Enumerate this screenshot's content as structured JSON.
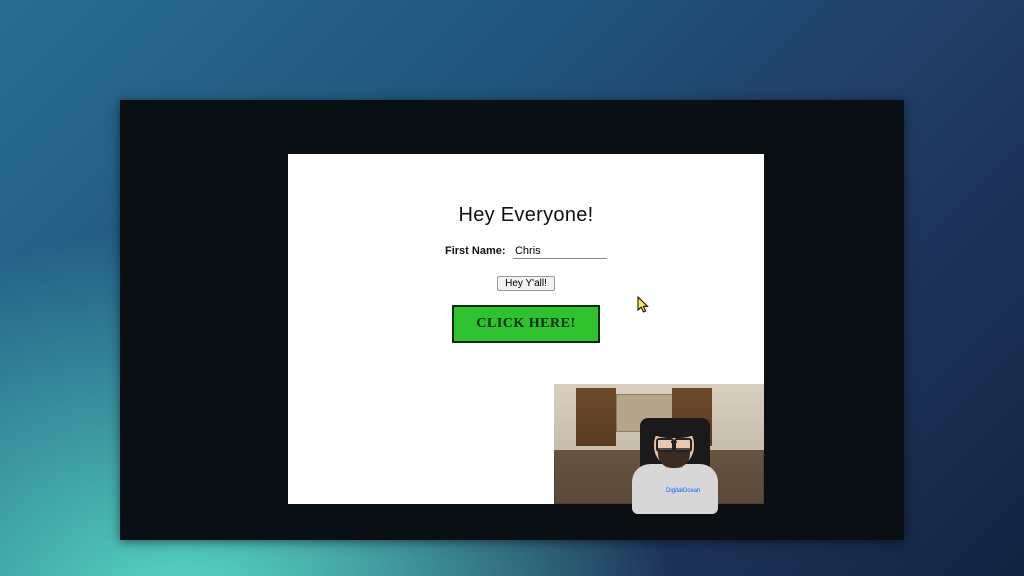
{
  "page": {
    "heading": "Hey Everyone!",
    "first_name_label": "First Name:",
    "first_name_value": "Chris",
    "small_button_label": "Hey Y'all!",
    "big_button_label": "CLICK HERE!"
  },
  "webcam": {
    "shirt_logo": "DigitalOcean"
  },
  "colors": {
    "big_button_bg": "#2fc22f",
    "big_button_border": "#0a2a0a"
  }
}
